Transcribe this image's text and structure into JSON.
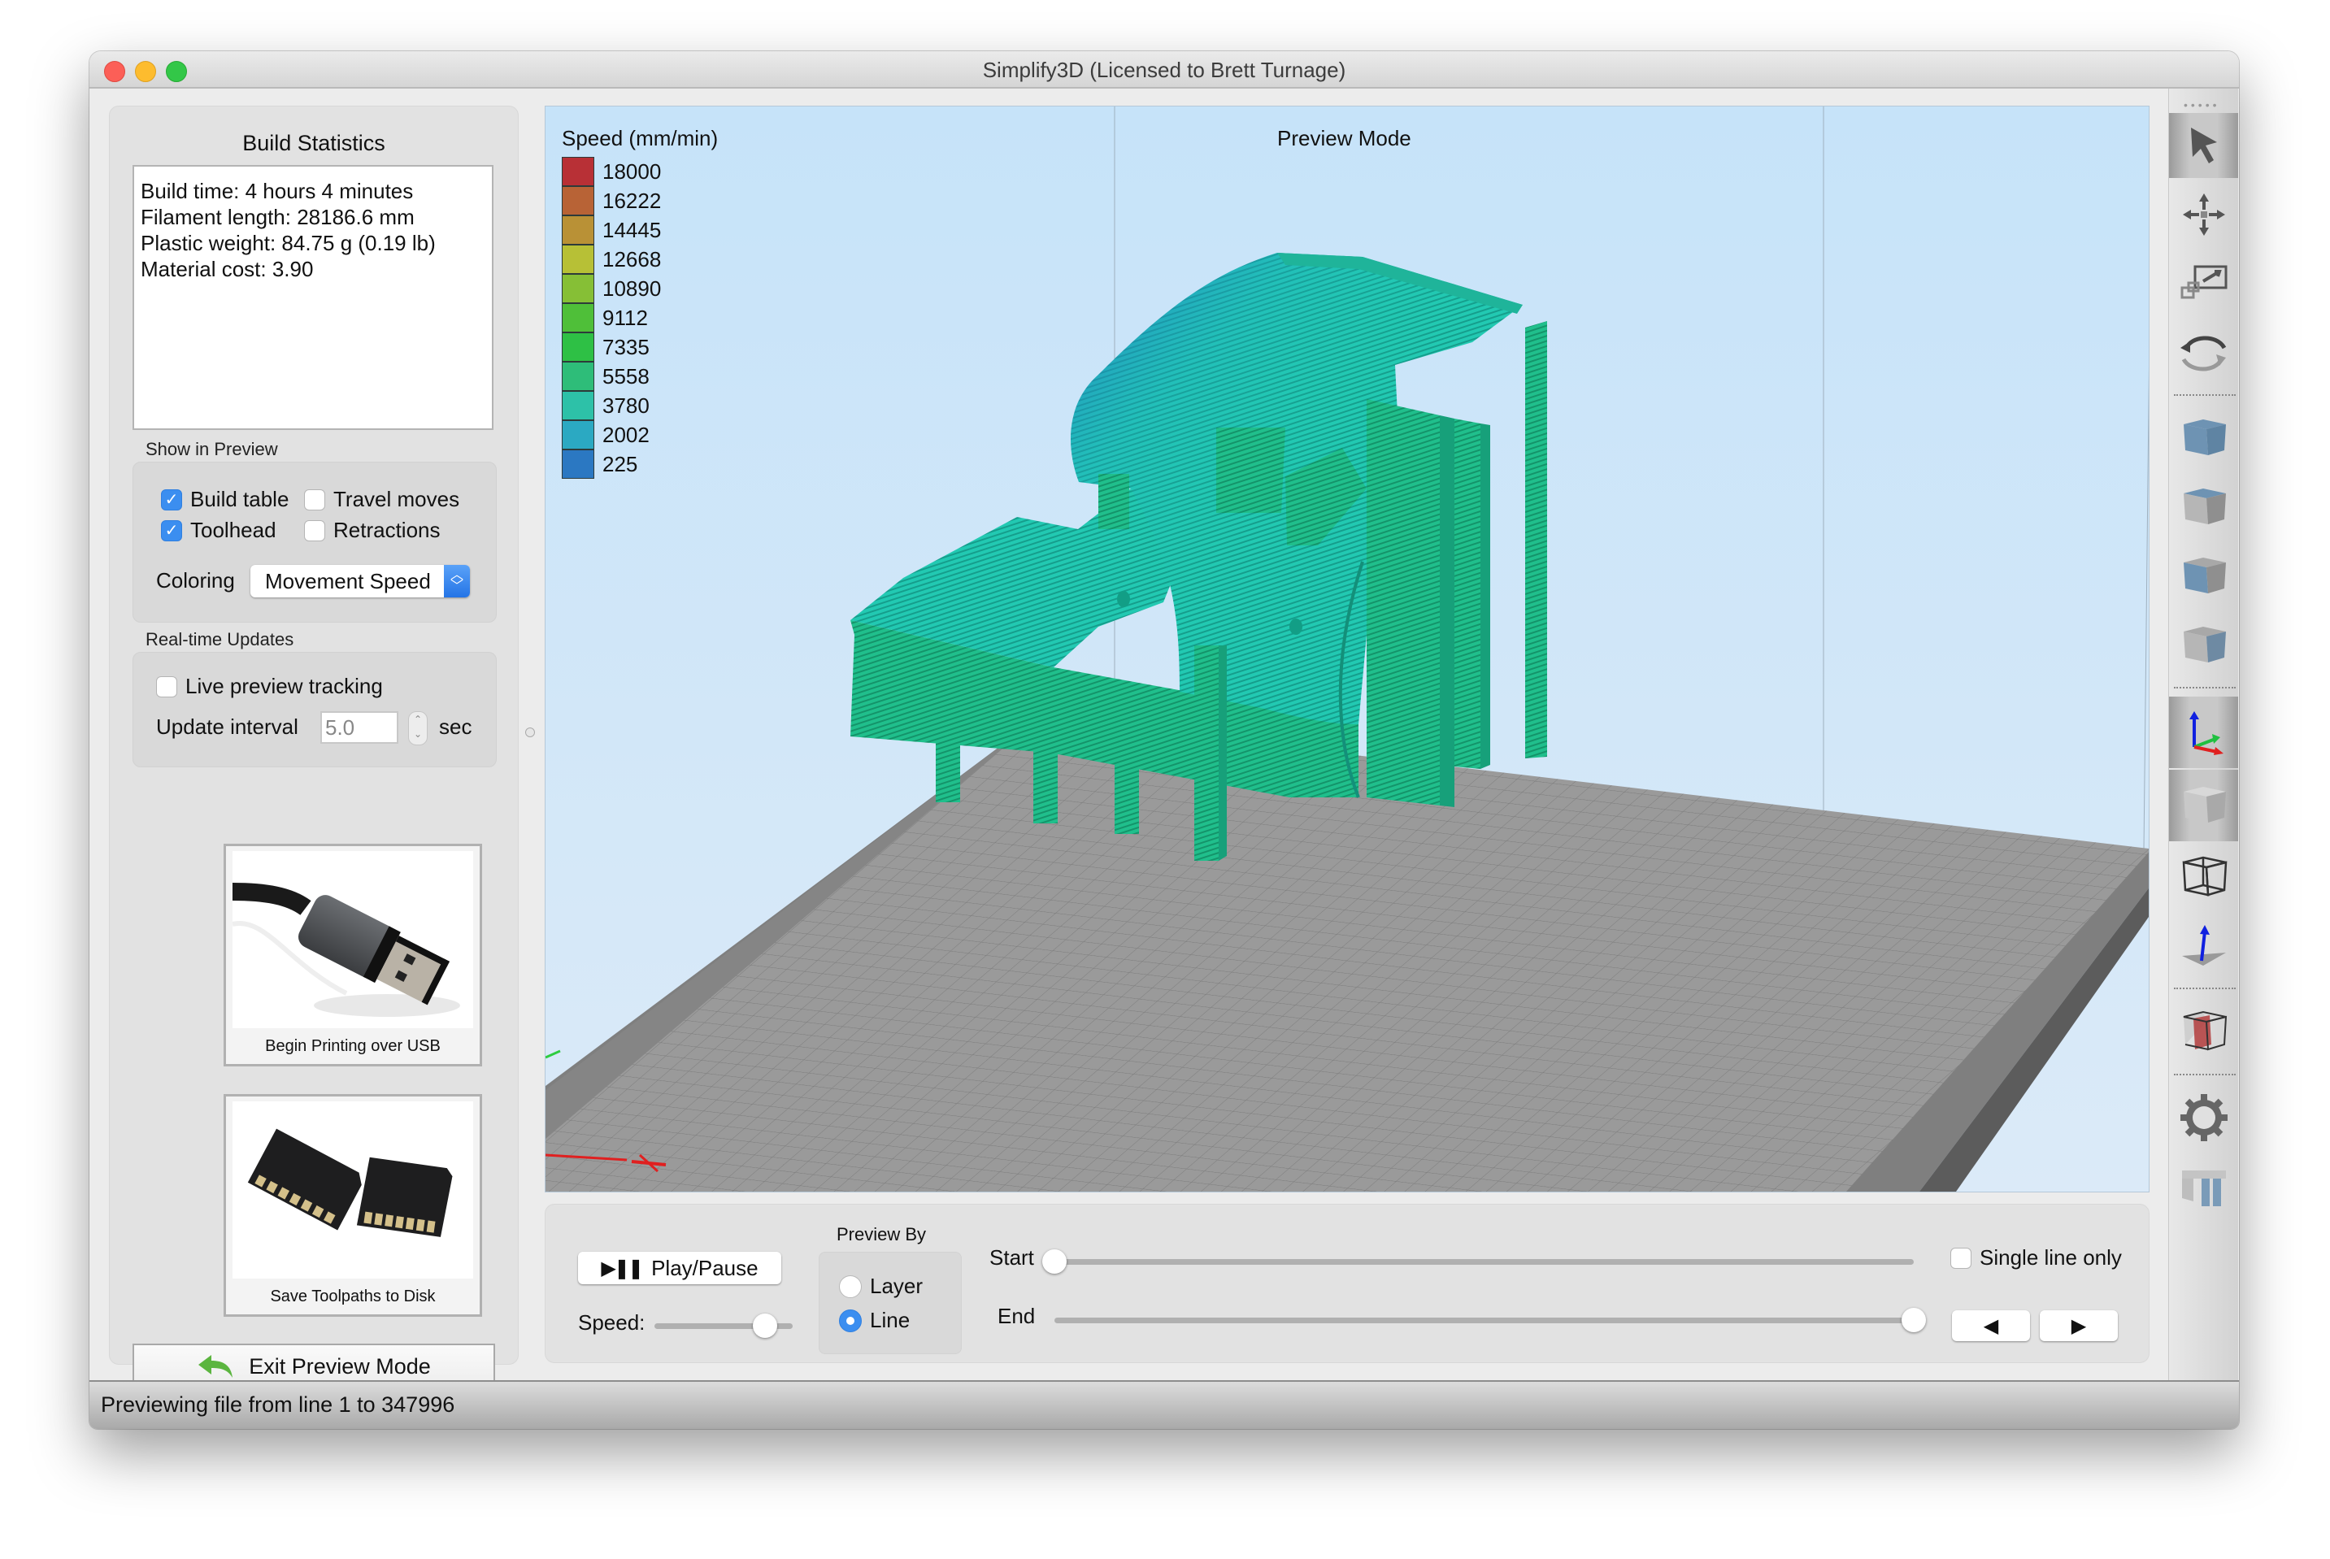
{
  "window": {
    "title": "Simplify3D (Licensed to Brett Turnage)"
  },
  "left_panel": {
    "build_statistics": {
      "heading": "Build Statistics",
      "lines": [
        "Build time: 4 hours 4 minutes",
        "Filament length: 28186.6 mm",
        "Plastic weight: 84.75 g (0.19 lb)",
        "Material cost: 3.90"
      ]
    },
    "show_in_preview": {
      "label": "Show in Preview",
      "checkboxes": [
        {
          "label": "Build table",
          "checked": true
        },
        {
          "label": "Travel moves",
          "checked": false
        },
        {
          "label": "Toolhead",
          "checked": true
        },
        {
          "label": "Retractions",
          "checked": false
        }
      ],
      "coloring_label": "Coloring",
      "coloring_value": "Movement Speed"
    },
    "realtime_updates": {
      "label": "Real-time Updates",
      "live_tracking_label": "Live preview tracking",
      "live_tracking_checked": false,
      "update_interval_label": "Update interval",
      "update_interval_value": "5.0",
      "unit": "sec"
    },
    "usb_button_label": "Begin Printing over USB",
    "disk_button_label": "Save Toolpaths to Disk",
    "exit_button_label": "Exit Preview Mode"
  },
  "viewport": {
    "mode_label": "Preview Mode",
    "legend": {
      "title": "Speed (mm/min)",
      "entries": [
        {
          "value": "18000",
          "color": "#b83036"
        },
        {
          "value": "16222",
          "color": "#b86336"
        },
        {
          "value": "14445",
          "color": "#b99136"
        },
        {
          "value": "12668",
          "color": "#b7c036"
        },
        {
          "value": "10890",
          "color": "#86bf36"
        },
        {
          "value": "9112",
          "color": "#4fbf39"
        },
        {
          "value": "7335",
          "color": "#2ec045"
        },
        {
          "value": "5558",
          "color": "#2ebd79"
        },
        {
          "value": "3780",
          "color": "#2dc1a8"
        },
        {
          "value": "2002",
          "color": "#2ba9c2"
        },
        {
          "value": "225",
          "color": "#2b78c2"
        }
      ]
    },
    "colors": {
      "model_face": "#22c9b2",
      "model_side": "#1fbf8c",
      "model_top_tint": "#1f6fc2",
      "plate_surface": "#9a9a9a",
      "plate_edge": "#7f7f7f",
      "plate_edge_dark": "#5c5c5c"
    }
  },
  "controls": {
    "play_pause_label": "Play/Pause",
    "speed_label": "Speed:",
    "speed_value": 0.8,
    "preview_by_label": "Preview By",
    "preview_by_options": [
      {
        "label": "Layer",
        "selected": false
      },
      {
        "label": "Line",
        "selected": true
      }
    ],
    "start_label": "Start",
    "start_value": 0.0,
    "end_label": "End",
    "end_value": 1.0,
    "single_line_label": "Single line only",
    "single_line_checked": false,
    "prev_symbol": "◀",
    "next_symbol": "▶"
  },
  "toolbar": {
    "tools": [
      {
        "name": "select-tool",
        "active": true
      },
      {
        "name": "move-tool",
        "active": false
      },
      {
        "name": "scale-tool",
        "active": false
      },
      {
        "name": "rotate-tool",
        "active": false
      },
      {
        "name": "view-top",
        "active": false
      },
      {
        "name": "view-bottom",
        "active": false
      },
      {
        "name": "view-front",
        "active": false
      },
      {
        "name": "view-side",
        "active": false
      },
      {
        "name": "show-axes",
        "active": true
      },
      {
        "name": "solid-view",
        "active": true
      },
      {
        "name": "wireframe-view",
        "active": false
      },
      {
        "name": "normals-view",
        "active": false
      },
      {
        "name": "cross-section",
        "active": false
      },
      {
        "name": "settings",
        "active": false
      },
      {
        "name": "supports",
        "active": false
      }
    ]
  },
  "status_bar": {
    "text": "Previewing file from line 1 to 347996"
  }
}
